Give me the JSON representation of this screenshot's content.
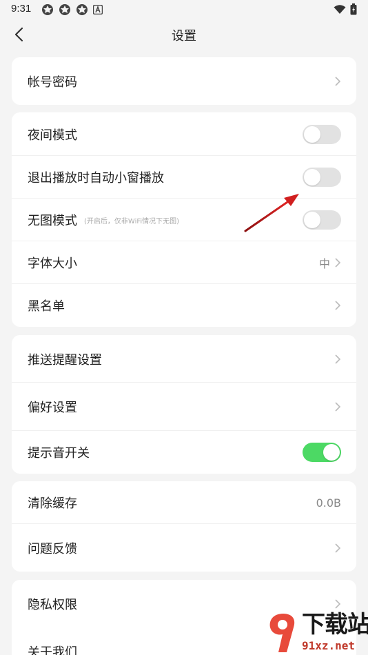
{
  "status_bar": {
    "time": "9:31"
  },
  "app_bar": {
    "title": "设置"
  },
  "sections": {
    "account": {
      "label": "帐号密码"
    },
    "display": {
      "night_mode": {
        "label": "夜间模式",
        "enabled": false
      },
      "auto_mini": {
        "label": "退出播放时自动小窗播放",
        "enabled": false
      },
      "no_image": {
        "label": "无图模式",
        "hint": "(开启后，仅非WiFi情况下无图)",
        "enabled": false
      },
      "font_size": {
        "label": "字体大小",
        "value": "中"
      },
      "blacklist": {
        "label": "黑名单"
      }
    },
    "prefs": {
      "push": {
        "label": "推送提醒设置"
      },
      "preferences": {
        "label": "偏好设置"
      },
      "sound": {
        "label": "提示音开关",
        "enabled": true
      }
    },
    "storage": {
      "clear_cache": {
        "label": "清除缓存",
        "value": "0.0B"
      },
      "feedback": {
        "label": "问题反馈"
      }
    },
    "about": {
      "privacy": {
        "label": "隐私权限"
      },
      "about_us": {
        "label": "关于我们"
      }
    }
  },
  "watermark": {
    "title": "下载站",
    "url": "91xz.net"
  },
  "colors": {
    "toggle_on": "#4cd964",
    "toggle_off": "#e2e2e2",
    "annotation_arrow": "#d11f1f"
  }
}
